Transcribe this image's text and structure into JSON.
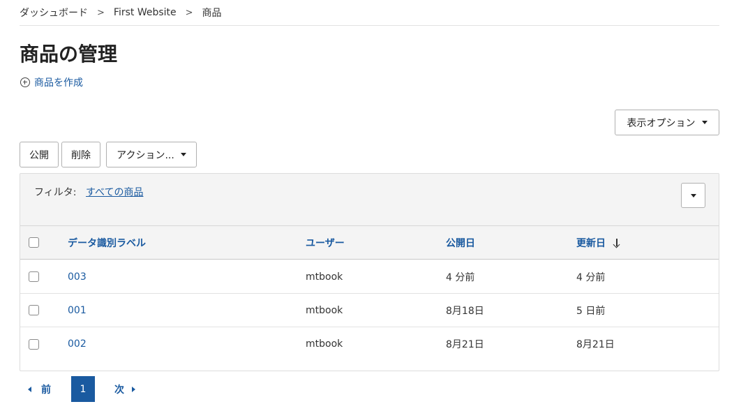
{
  "breadcrumb": [
    "ダッシュボード",
    "First Website",
    "商品"
  ],
  "breadcrumb_separator": ">",
  "page_title": "商品の管理",
  "create_link": "商品を作成",
  "display_options_label": "表示オプション",
  "toolbar": {
    "publish_label": "公開",
    "delete_label": "削除",
    "actions_label": "アクション..."
  },
  "filter": {
    "label": "フィルタ:",
    "value": "すべての商品"
  },
  "table": {
    "headers": {
      "label": "データ識別ラベル",
      "user": "ユーザー",
      "published": "公開日",
      "updated": "更新日"
    },
    "sort_column": "updated",
    "sort_direction": "desc",
    "rows": [
      {
        "label": "003",
        "user": "mtbook",
        "published": "4 分前",
        "updated": "4 分前"
      },
      {
        "label": "001",
        "user": "mtbook",
        "published": "8月18日",
        "updated": "5 日前"
      },
      {
        "label": "002",
        "user": "mtbook",
        "published": "8月21日",
        "updated": "8月21日"
      }
    ]
  },
  "pagination": {
    "prev_label": "前",
    "current_page": "1",
    "next_label": "次"
  },
  "colors": {
    "link": "#1a5aa0",
    "header_bg": "#f4f4f4",
    "current_page_bg": "#1a5aa0"
  }
}
